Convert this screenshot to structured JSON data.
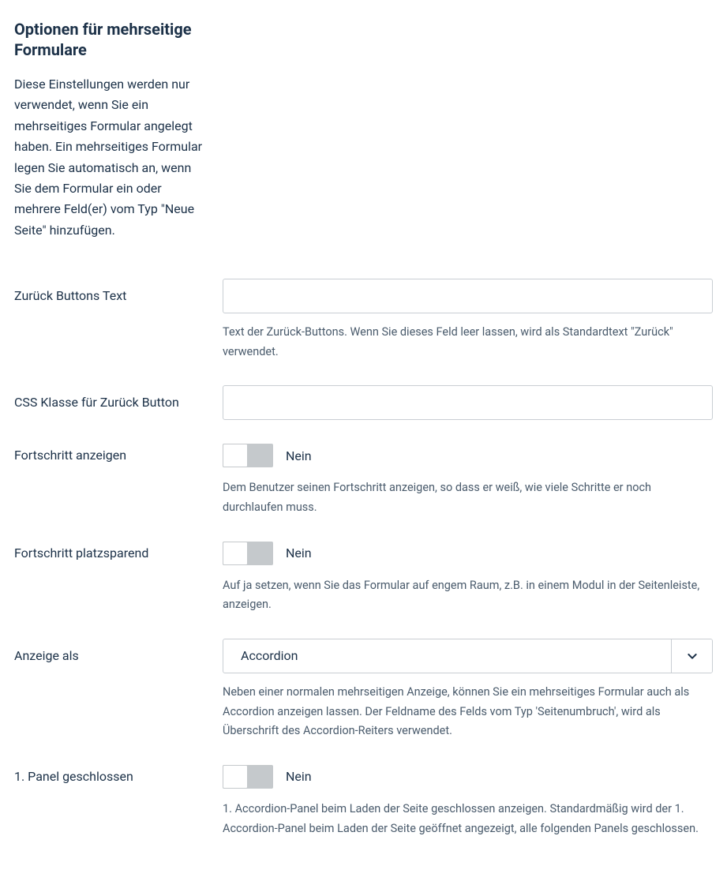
{
  "header": {
    "title": "Optionen für mehrseitige Formulare",
    "description": "Diese Einstellungen werden nur verwendet, wenn Sie ein mehrseitiges Formular angelegt haben. Ein mehrseitiges Formular legen Sie automatisch an, wenn Sie dem Formular ein oder mehrere Feld(er) vom Typ \"Neue Seite\" hinzufügen."
  },
  "fields": {
    "back_button_text": {
      "label": "Zurück Buttons Text",
      "value": "",
      "help": "Text der Zurück-Buttons. Wenn Sie dieses Feld leer lassen, wird als Standardtext \"Zurück\" verwendet."
    },
    "css_class_back": {
      "label": "CSS Klasse für Zurück Button",
      "value": ""
    },
    "show_progress": {
      "label": "Fortschritt anzeigen",
      "state_label": "Nein",
      "help": "Dem Benutzer seinen Fortschritt anzeigen, so dass er weiß, wie viele Schritte er noch durchlaufen muss."
    },
    "progress_compact": {
      "label": "Fortschritt platzsparend",
      "state_label": "Nein",
      "help": "Auf ja setzen, wenn Sie das Formular auf engem Raum, z.B. in einem Modul in der Seitenleiste, anzeigen."
    },
    "display_as": {
      "label": "Anzeige als",
      "selected": "Accordion",
      "help": "Neben einer normalen mehrseitigen Anzeige, können Sie ein mehrseitiges Formular auch als Accordion anzeigen lassen. Der Feldname des Felds vom Typ 'Seitenumbruch', wird als Überschrift des Accordion-Reiters verwendet."
    },
    "first_panel_closed": {
      "label": "1. Panel geschlossen",
      "state_label": "Nein",
      "help": "1. Accordion-Panel beim Laden der Seite geschlossen anzeigen. Standardmäßig wird der 1. Accordion-Panel beim Laden der Seite geöffnet angezeigt, alle folgenden Panels geschlossen."
    }
  }
}
